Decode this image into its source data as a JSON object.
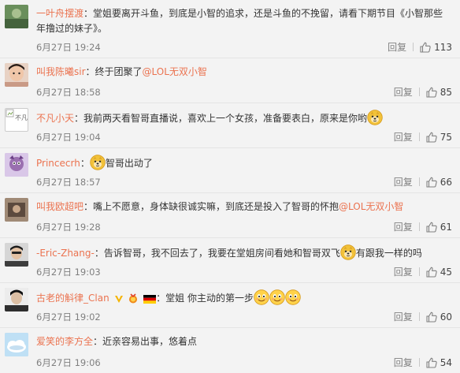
{
  "reply_label": "回复",
  "comments": [
    {
      "user": "一叶舟摆渡",
      "text": "：堂姐要离开斗鱼，到底是小智的追求，还是斗鱼的不挽留，请看下期节目《小智那些年撸过的妹子》。",
      "time": "6月27日 19:24",
      "likes": "113",
      "avatar_color": "#6a8f5c"
    },
    {
      "user": "叫我陈曦sir",
      "text_pre": "：终于团聚了",
      "mention": "@LOL无双小智",
      "time": "6月27日 18:58",
      "likes": "85",
      "avatar_color": "#c99a86"
    },
    {
      "user": "不凡小天",
      "text": "：我前两天看智哥直播说，喜欢上一个女孩，准备要表白，原来是你哟",
      "avatar_alt": "不凡",
      "time": "6月27日 19:04",
      "likes": "75",
      "avatar_color": "#ffffff"
    },
    {
      "user": "Princecrh",
      "text": "智哥出动了",
      "time": "6月27日 18:57",
      "likes": "66",
      "avatar_color": "#9a6fb0"
    },
    {
      "user": "叫我欧超吧",
      "text_pre": "：嘴上不愿意，身体缺很诚实嘛，到底还是投入了智哥的怀抱",
      "mention": "@LOL无双小智",
      "time": "6月27日 19:28",
      "likes": "61",
      "avatar_color": "#5c4a3e"
    },
    {
      "user": "-Eric-Zhang-",
      "text": "：告诉智哥，我不回去了，我要在堂姐房间看她和智哥双飞",
      "text_post": "有跟我一样的吗",
      "time": "6月27日 19:03",
      "likes": "45",
      "avatar_color": "#3d3d3d"
    },
    {
      "user": "古老的斛律_Clan",
      "text": "：堂姐 你主动的第一步",
      "time": "6月27日 19:02",
      "likes": "60",
      "avatar_color": "#2e2e2e"
    },
    {
      "user": "爱笑的李方全",
      "text": "：近亲容易出事，悠着点",
      "time": "6月27日 19:06",
      "likes": "54",
      "avatar_color": "#7fb7e0"
    }
  ],
  "colors": {
    "username": "#eb7350",
    "meta": "#808080",
    "background": "#f3f3f3"
  }
}
